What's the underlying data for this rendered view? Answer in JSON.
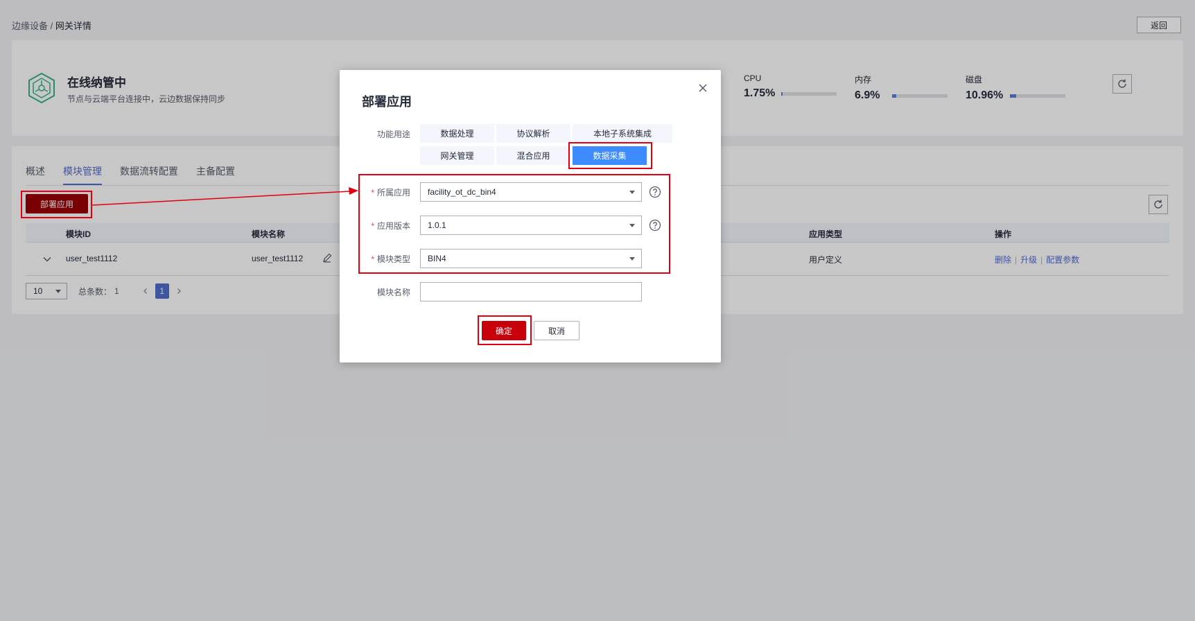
{
  "breadcrumb": {
    "parent": "边缘设备",
    "separator": "/",
    "current": "网关详情"
  },
  "header": {
    "back_label": "返回"
  },
  "status": {
    "title": "在线纳管中",
    "description": "节点与云端平台连接中，云边数据保持同步",
    "metrics": [
      {
        "label": "CPU",
        "value": "1.75%",
        "level": 0.0175
      },
      {
        "label": "内存",
        "value": "6.9%",
        "level": 0.069
      },
      {
        "label": "磁盘",
        "value": "10.96%",
        "level": 0.1096
      }
    ]
  },
  "tabs": [
    {
      "label": "概述",
      "active": false
    },
    {
      "label": "模块管理",
      "active": true
    },
    {
      "label": "数据流转配置",
      "active": false
    },
    {
      "label": "主备配置",
      "active": false
    }
  ],
  "toolbar": {
    "deploy_label": "部署应用"
  },
  "table": {
    "columns": {
      "id": "模块ID",
      "name": "模块名称",
      "type": "应用类型",
      "ops": "操作"
    },
    "rows": [
      {
        "id": "user_test1112",
        "name": "user_test1112",
        "type": "用户定义",
        "ops": {
          "delete": "删除",
          "upgrade": "升级",
          "config": "配置参数"
        }
      }
    ]
  },
  "pagination": {
    "page_size": "10",
    "total_label": "总条数：",
    "total": "1",
    "current_page": "1"
  },
  "dialog": {
    "title": "部署应用",
    "purpose_label": "功能用途",
    "purposes": [
      {
        "label": "数据处理",
        "active": false
      },
      {
        "label": "协议解析",
        "active": false
      },
      {
        "label": "本地子系统集成",
        "active": false
      },
      {
        "label": "网关管理",
        "active": false
      },
      {
        "label": "混合应用",
        "active": false
      },
      {
        "label": "数据采集",
        "active": true
      }
    ],
    "fields": {
      "app": {
        "label": "所属应用",
        "value": "facility_ot_dc_bin4",
        "required": "*"
      },
      "version": {
        "label": "应用版本",
        "value": "1.0.1",
        "required": "*"
      },
      "module_type": {
        "label": "模块类型",
        "value": "BIN4",
        "required": "*"
      },
      "module_name": {
        "label": "模块名称",
        "value": ""
      }
    },
    "ok_label": "确定",
    "cancel_label": "取消"
  },
  "colors": {
    "primary": "#526ecc",
    "deploy": "#9a0007",
    "ok": "#c7000b",
    "chip_active": "#3d8bff",
    "annotation": "#e0000f"
  }
}
